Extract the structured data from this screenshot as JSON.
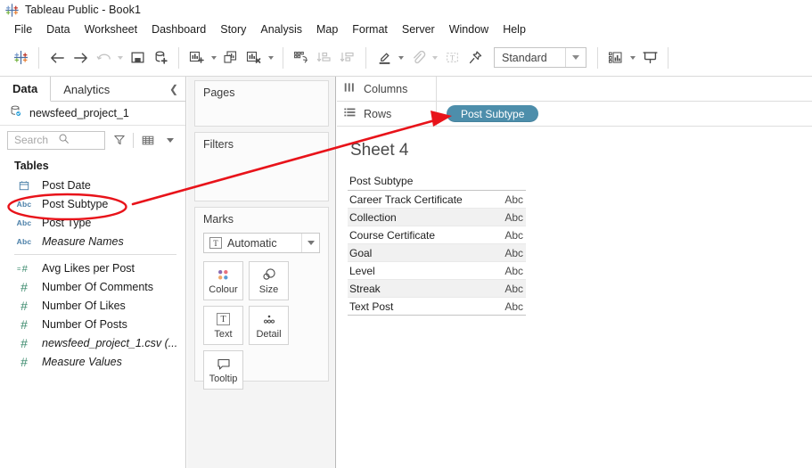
{
  "window": {
    "title": "Tableau Public - Book1",
    "logo_icon": "tableau-logo-icon"
  },
  "menubar": {
    "items": [
      {
        "label": "File"
      },
      {
        "label": "Data"
      },
      {
        "label": "Worksheet"
      },
      {
        "label": "Dashboard"
      },
      {
        "label": "Story"
      },
      {
        "label": "Analysis"
      },
      {
        "label": "Map"
      },
      {
        "label": "Format"
      },
      {
        "label": "Server"
      },
      {
        "label": "Window"
      },
      {
        "label": "Help"
      }
    ]
  },
  "toolbar": {
    "tableau_home_icon": "tableau-logo-icon",
    "back_icon": "arrow-left-icon",
    "forward_icon": "arrow-right-icon",
    "undo_icon": "undo-icon",
    "save_icon": "save-icon",
    "new_data_source_icon": "new-data-source-icon",
    "new_worksheet_icon": "new-worksheet-icon",
    "duplicate_sheet_icon": "duplicate-sheet-icon",
    "clear_sheet_icon": "clear-sheet-icon",
    "swap_rows_columns_icon": "swap-rows-columns-icon",
    "sort_ascending_icon": "sort-ascending-icon",
    "sort_descending_icon": "sort-descending-icon",
    "highlight_icon": "highlight-icon",
    "group_members_icon": "paperclip-group-icon",
    "show_mark_labels_icon": "text-label-icon",
    "fix_axes_icon": "pin-icon",
    "fit_value": "Standard",
    "fit_caret_icon": "chevron-down-icon",
    "show_me_icon": "show-me-icon",
    "presentation_mode_icon": "presentation-mode-icon"
  },
  "left_pane": {
    "tabs": [
      {
        "label": "Data",
        "active": true
      },
      {
        "label": "Analytics",
        "active": false
      }
    ],
    "collapse_icon": "collapse-panel-icon",
    "data_source": {
      "name": "newsfeed_project_1",
      "icon": "data-source-connected-icon"
    },
    "search": {
      "placeholder": "Search",
      "search_icon": "search-icon",
      "filter_icon": "filter-funnel-icon",
      "view_icon": "list-view-icon",
      "view_caret_icon": "chevron-down-icon"
    },
    "section_header": "Tables",
    "fields": [
      {
        "name": "Post Date",
        "type_icon": "calendar-icon",
        "italic": false,
        "highlighted": false
      },
      {
        "name": "Post Subtype",
        "type_icon": "abc-icon",
        "italic": false,
        "highlighted": true
      },
      {
        "name": "Post Type",
        "type_icon": "abc-icon",
        "italic": false,
        "highlighted": false
      },
      {
        "name": "Measure Names",
        "type_icon": "abc-icon",
        "italic": true,
        "highlighted": false
      }
    ],
    "measures": [
      {
        "name": "Avg Likes per Post",
        "type_icon": "calculated-number-icon",
        "italic": false
      },
      {
        "name": "Number Of Comments",
        "type_icon": "number-icon",
        "italic": false
      },
      {
        "name": "Number Of Likes",
        "type_icon": "number-icon",
        "italic": false
      },
      {
        "name": "Number Of Posts",
        "type_icon": "number-icon",
        "italic": false
      },
      {
        "name": "newsfeed_project_1.csv (...",
        "type_icon": "number-icon",
        "italic": true
      },
      {
        "name": "Measure Values",
        "type_icon": "number-icon",
        "italic": true
      }
    ]
  },
  "cards": {
    "pages_title": "Pages",
    "filters_title": "Filters",
    "marks_title": "Marks",
    "marks_type": {
      "value": "Automatic",
      "icon": "text-mark-icon",
      "caret_icon": "chevron-down-icon"
    },
    "shelves": [
      {
        "label": "Colour",
        "icon": "colour-palette-icon"
      },
      {
        "label": "Size",
        "icon": "size-circles-icon"
      },
      {
        "label": "Text",
        "icon": "text-label-icon"
      },
      {
        "label": "Detail",
        "icon": "detail-dots-icon"
      },
      {
        "label": "Tooltip",
        "icon": "tooltip-bubble-icon"
      }
    ]
  },
  "shelves": {
    "columns": {
      "label": "Columns",
      "icon": "columns-icon",
      "pills": []
    },
    "rows": {
      "label": "Rows",
      "icon": "rows-icon",
      "pills": [
        {
          "label": "Post Subtype"
        }
      ]
    }
  },
  "worksheet": {
    "title": "Sheet 4",
    "table": {
      "columns": [
        "Post Subtype",
        ""
      ],
      "rows": [
        {
          "label": "Career Track Certificate",
          "value": "Abc"
        },
        {
          "label": "Collection",
          "value": "Abc"
        },
        {
          "label": "Course Certificate",
          "value": "Abc"
        },
        {
          "label": "Goal",
          "value": "Abc"
        },
        {
          "label": "Level",
          "value": "Abc"
        },
        {
          "label": "Streak",
          "value": "Abc"
        },
        {
          "label": "Text Post",
          "value": "Abc"
        }
      ]
    }
  },
  "annotations": {
    "colour": "#e8131a",
    "ellipse": {
      "label": "highlight-ellipse-post-subtype-field"
    },
    "arrow": {
      "label": "arrow-field-to-rows-pill"
    }
  },
  "colors": {
    "pill_blue": "#4d8eab",
    "annotation_red": "#e8131a",
    "dimension_blue": "#4a7fa8",
    "measure_green": "#3d8b6e"
  }
}
